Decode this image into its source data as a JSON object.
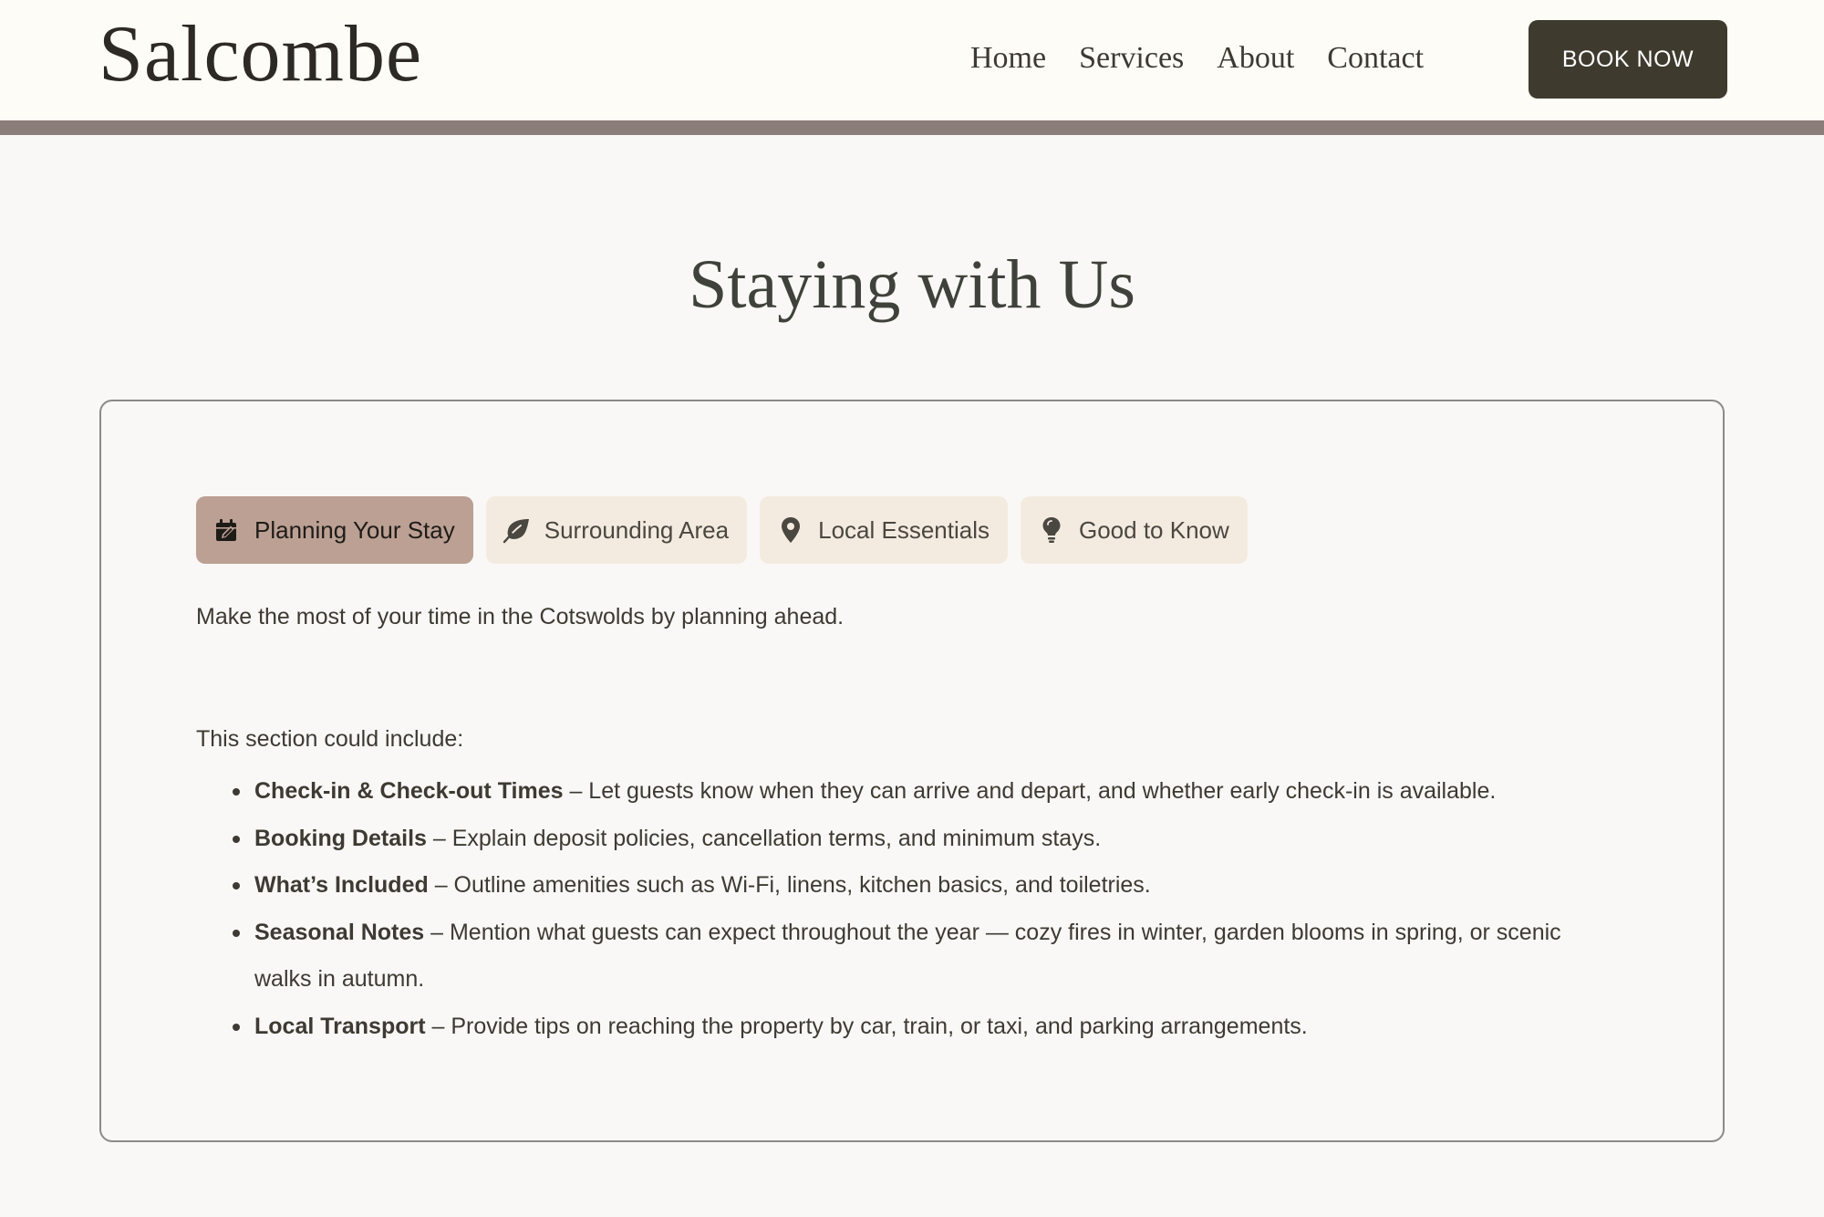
{
  "header": {
    "logo": "Salcombe",
    "nav": [
      {
        "label": "Home"
      },
      {
        "label": "Services"
      },
      {
        "label": "About"
      },
      {
        "label": "Contact"
      }
    ],
    "cta_label": "BOOK NOW"
  },
  "page": {
    "title": "Staying with Us"
  },
  "tabs": [
    {
      "label": "Planning Your Stay",
      "icon": "calendar-edit-icon",
      "active": true
    },
    {
      "label": "Surrounding Area",
      "icon": "leaf-icon",
      "active": false
    },
    {
      "label": "Local Essentials",
      "icon": "map-pin-icon",
      "active": false
    },
    {
      "label": "Good to Know",
      "icon": "lightbulb-icon",
      "active": false
    }
  ],
  "content": {
    "intro": "Make the most of your time in the Cotswolds by planning ahead.",
    "lead": "This section could include:",
    "items": [
      {
        "term": "Check-in & Check-out Times",
        "desc": " – Let guests know when they can arrive and depart, and whether early check-in is available."
      },
      {
        "term": "Booking Details",
        "desc": " – Explain deposit policies, cancellation terms, and minimum stays."
      },
      {
        "term": "What’s Included",
        "desc": " – Outline amenities such as Wi-Fi, linens, kitchen basics, and toiletries."
      },
      {
        "term": "Seasonal Notes",
        "desc": " – Mention what guests can expect throughout the year — cozy fires in winter, garden blooms in spring, or scenic walks in autumn."
      },
      {
        "term": "Local Transport",
        "desc": " – Provide tips on reaching the property by car, train, or taxi, and parking arrangements."
      }
    ]
  },
  "colors": {
    "header_bg": "#fefcf7",
    "header_bar": "#8b7d7a",
    "cta_bg": "#3e3a2e",
    "tab_active_bg": "#bca094",
    "tab_bg": "#f4ebe0",
    "page_bg": "#f9f8f6"
  }
}
